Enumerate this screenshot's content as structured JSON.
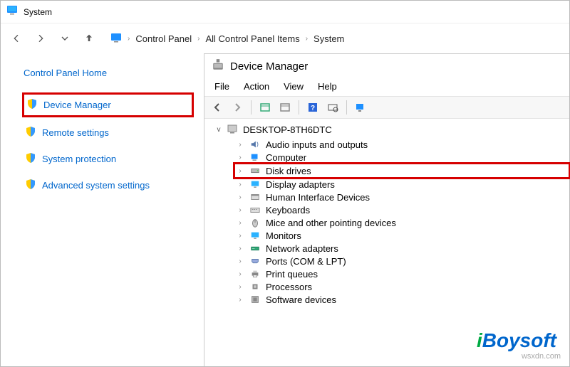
{
  "window": {
    "title": "System"
  },
  "nav": {
    "breadcrumb": [
      "Control Panel",
      "All Control Panel Items",
      "System"
    ]
  },
  "sidebar": {
    "home": "Control Panel Home",
    "items": [
      {
        "label": "Device Manager",
        "highlight": true
      },
      {
        "label": "Remote settings",
        "highlight": false
      },
      {
        "label": "System protection",
        "highlight": false
      },
      {
        "label": "Advanced system settings",
        "highlight": false
      }
    ]
  },
  "dm": {
    "title": "Device Manager",
    "menu": [
      "File",
      "Action",
      "View",
      "Help"
    ],
    "root": "DESKTOP-8TH6DTC",
    "nodes": [
      {
        "label": "Audio inputs and outputs",
        "icon": "audio",
        "hl": false
      },
      {
        "label": "Computer",
        "icon": "computer",
        "hl": false
      },
      {
        "label": "Disk drives",
        "icon": "disk",
        "hl": true
      },
      {
        "label": "Display adapters",
        "icon": "display",
        "hl": false
      },
      {
        "label": "Human Interface Devices",
        "icon": "hid",
        "hl": false
      },
      {
        "label": "Keyboards",
        "icon": "keyboard",
        "hl": false
      },
      {
        "label": "Mice and other pointing devices",
        "icon": "mouse",
        "hl": false
      },
      {
        "label": "Monitors",
        "icon": "monitor",
        "hl": false
      },
      {
        "label": "Network adapters",
        "icon": "network",
        "hl": false
      },
      {
        "label": "Ports (COM & LPT)",
        "icon": "port",
        "hl": false
      },
      {
        "label": "Print queues",
        "icon": "printer",
        "hl": false
      },
      {
        "label": "Processors",
        "icon": "cpu",
        "hl": false
      },
      {
        "label": "Software devices",
        "icon": "software",
        "hl": false
      }
    ]
  },
  "watermark": "wsxdn.com",
  "logo": {
    "a": "i",
    "b": "Boy",
    "c": "soft"
  }
}
